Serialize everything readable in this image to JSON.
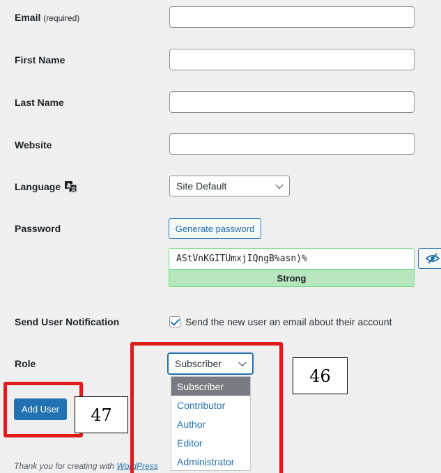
{
  "form": {
    "email_label": "Email",
    "email_required": "(required)",
    "first_name_label": "First Name",
    "last_name_label": "Last Name",
    "website_label": "Website",
    "language_label": "Language",
    "language_value": "Site Default",
    "password_label": "Password",
    "generate_password_label": "Generate password",
    "password_value": "AStVnKGITUmxjIQngB%asn)%",
    "password_strength": "Strong",
    "notification_label": "Send User Notification",
    "notification_text": "Send the new user an email about their account",
    "role_label": "Role",
    "role_value": "Subscriber",
    "add_user_label": "Add User"
  },
  "role_options": [
    "Subscriber",
    "Contributor",
    "Author",
    "Editor",
    "Administrator"
  ],
  "annotations": {
    "box_46": "46",
    "box_47": "47"
  },
  "footer": {
    "text": "Thank you for creating with ",
    "link": "WordPress"
  },
  "colors": {
    "accent": "#2271b1",
    "highlight": "#e01b1b",
    "strength_bg": "#b8e6bf",
    "selected_option": "#787c82"
  }
}
